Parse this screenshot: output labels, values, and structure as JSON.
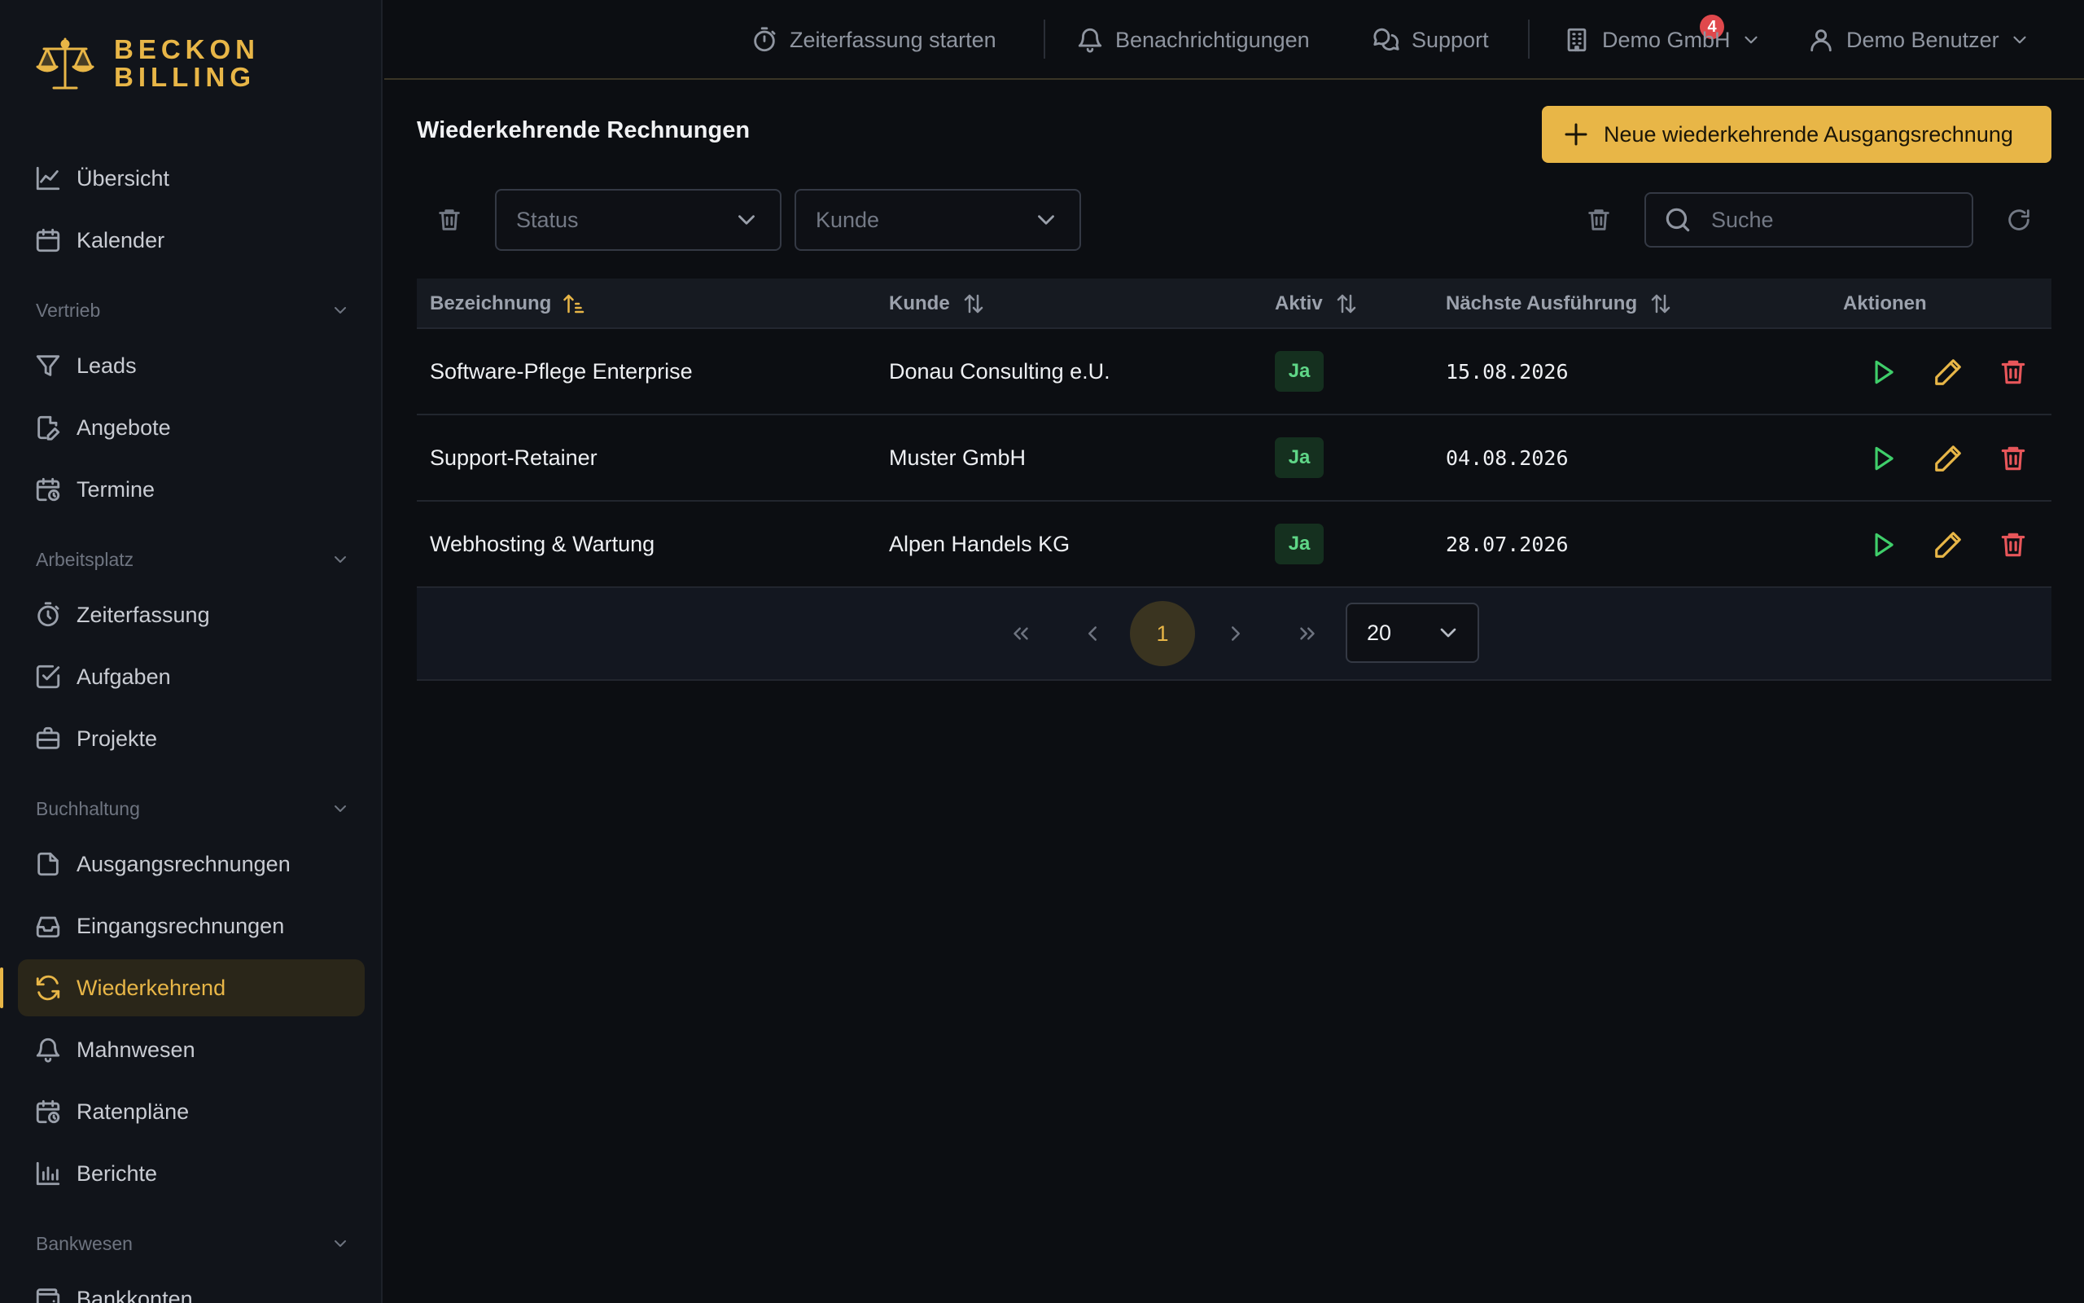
{
  "brand": {
    "line1": "BECKON",
    "line2": "BILLING",
    "accent": "#e8b647"
  },
  "topbar": {
    "timer_label": "Zeiterfassung starten",
    "notifications_label": "Benachrichtigungen",
    "notifications_count": "4",
    "support_label": "Support",
    "company_label": "Demo GmbH",
    "user_label": "Demo Benutzer"
  },
  "sidebar": {
    "items": {
      "overview": "Übersicht",
      "calendar": "Kalender",
      "leads": "Leads",
      "quotes": "Angebote",
      "appointments": "Termine",
      "time_tracking": "Zeiterfassung",
      "tasks": "Aufgaben",
      "projects": "Projekte",
      "outgoing_invoices": "Ausgangsrechnungen",
      "incoming_invoices": "Eingangsrechnungen",
      "recurring": "Wiederkehrend",
      "dunning": "Mahnwesen",
      "installments": "Ratenpläne",
      "reports": "Berichte",
      "bank_accounts": "Bankkonten"
    },
    "sections": {
      "sales": "Vertrieb",
      "workplace": "Arbeitsplatz",
      "accounting": "Buchhaltung",
      "banking": "Bankwesen"
    }
  },
  "main": {
    "title": "Wiederkehrende Rechnungen",
    "new_button": "Neue wiederkehrende Ausgangsrechnung",
    "filters": {
      "status_placeholder": "Status",
      "customer_placeholder": "Kunde"
    },
    "search": {
      "placeholder": "Suche",
      "value": ""
    },
    "table": {
      "columns": {
        "name": "Bezeichnung",
        "customer": "Kunde",
        "active": "Aktiv",
        "next_run": "Nächste Ausführung",
        "actions": "Aktionen"
      },
      "rows": [
        {
          "name": "Software-Pflege Enterprise",
          "customer": "Donau Consulting e.U.",
          "active": "Ja",
          "next_run": "15.08.2026"
        },
        {
          "name": "Support-Retainer",
          "customer": "Muster GmbH",
          "active": "Ja",
          "next_run": "04.08.2026"
        },
        {
          "name": "Webhosting & Wartung",
          "customer": "Alpen Handels KG",
          "active": "Ja",
          "next_run": "28.07.2026"
        }
      ]
    },
    "pagination": {
      "current_page": "1",
      "page_size": "20"
    }
  }
}
